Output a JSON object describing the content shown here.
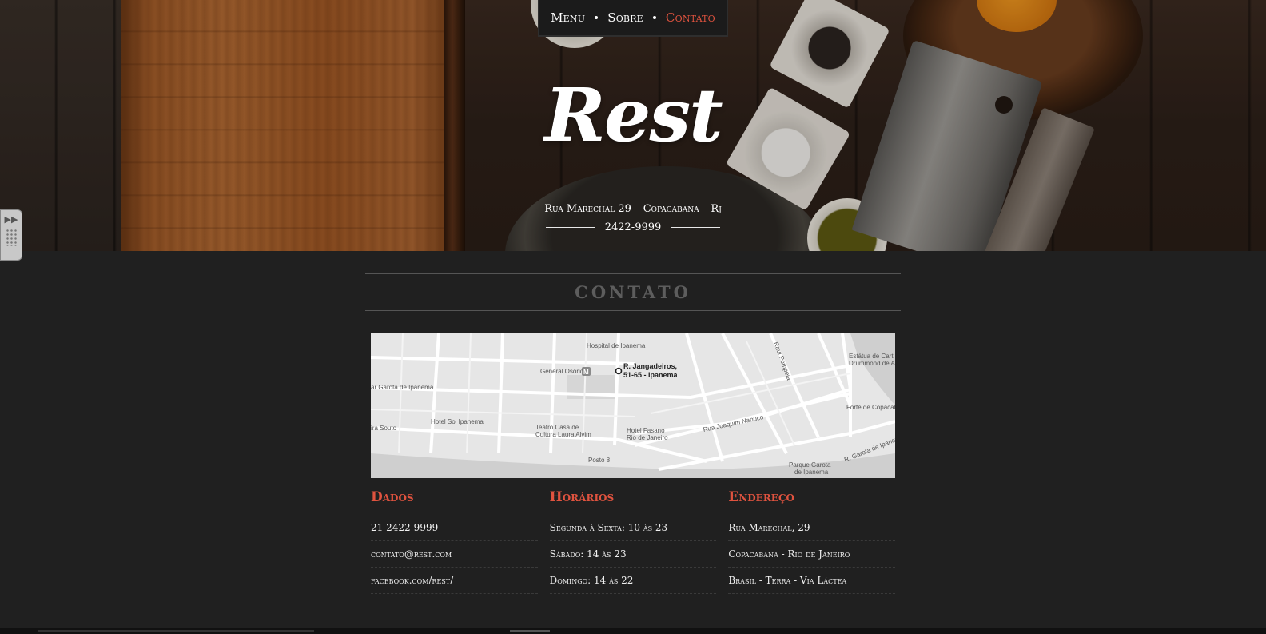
{
  "nav": {
    "items": [
      {
        "label": "Menu",
        "active": false
      },
      {
        "label": "Sobre",
        "active": false
      },
      {
        "label": "Contato",
        "active": true
      }
    ]
  },
  "hero": {
    "logo": "Rest",
    "address": "Rua Marechal 29 – Copacabana – Rj",
    "phone": "2422-9999"
  },
  "section": {
    "title": "CONTATO"
  },
  "map": {
    "labels": {
      "hospital": "Hospital de Ipanema",
      "general": "General Osório",
      "pin_line1": "R. Jangadeiros,",
      "pin_line2": "51-65 - Ipanema",
      "garota": "ar Garota de Ipanema",
      "sol": "Hotel Sol Ipanema",
      "souto": "ira Souto",
      "teatro_line1": "Teatro Casa de",
      "teatro_line2": "Cultura Laura Alvim",
      "fasano_line1": "Hotel Fasano",
      "fasano_line2": "Rio de Janeiro",
      "nabuco": "Rua Joaquim Nabuco",
      "posto": "Posto 8",
      "pompeia": "Raul Pompéia",
      "estatua_line1": "Estátua de Cart",
      "estatua_line2": "Drummond de A",
      "forte": "Forte de Copacab",
      "parque_line1": "Parque Garota",
      "parque_line2": "de Ipanema",
      "rgarota": "R. Garota de Ipanem"
    }
  },
  "columns": [
    {
      "title": "Dados",
      "rows": [
        "21 2422-9999",
        "contato@rest.com",
        "facebook.com/rest/"
      ]
    },
    {
      "title": "Horários",
      "rows": [
        "Segunda à Sexta: 10 às 23",
        "Sábado: 14 às 23",
        "Domingo: 14 às 22"
      ]
    },
    {
      "title": "Endereço",
      "rows": [
        "Rua Marechal, 29",
        "Copacabana - Rio de Janeiro",
        "Brasil - Terra - Via Láctea"
      ]
    }
  ],
  "colors": {
    "accent": "#e0533f",
    "background": "#202020",
    "nav_bg": "#1b1b1b"
  }
}
